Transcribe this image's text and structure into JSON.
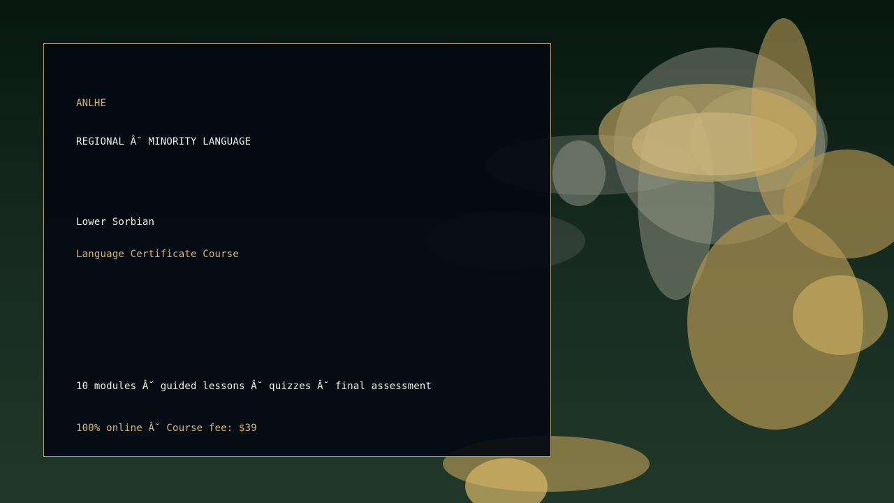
{
  "brand": "ANLHE",
  "category": "REGIONAL Â˘ MINORITY LANGUAGE",
  "language_name": "Lower Sorbian",
  "course_type": "Language Certificate Course",
  "features": "10 modules Â˘ guided lessons Â˘ quizzes Â˘ final assessment",
  "pricing": "100% online Â˘ Course fee: $39",
  "colors": {
    "accent_gold": "#d7b977",
    "text_light": "#f3f3ee",
    "card_border": "#b59d63",
    "card_background": "#040a12",
    "background_top": "#07170f",
    "background_bottom": "#20382a"
  }
}
